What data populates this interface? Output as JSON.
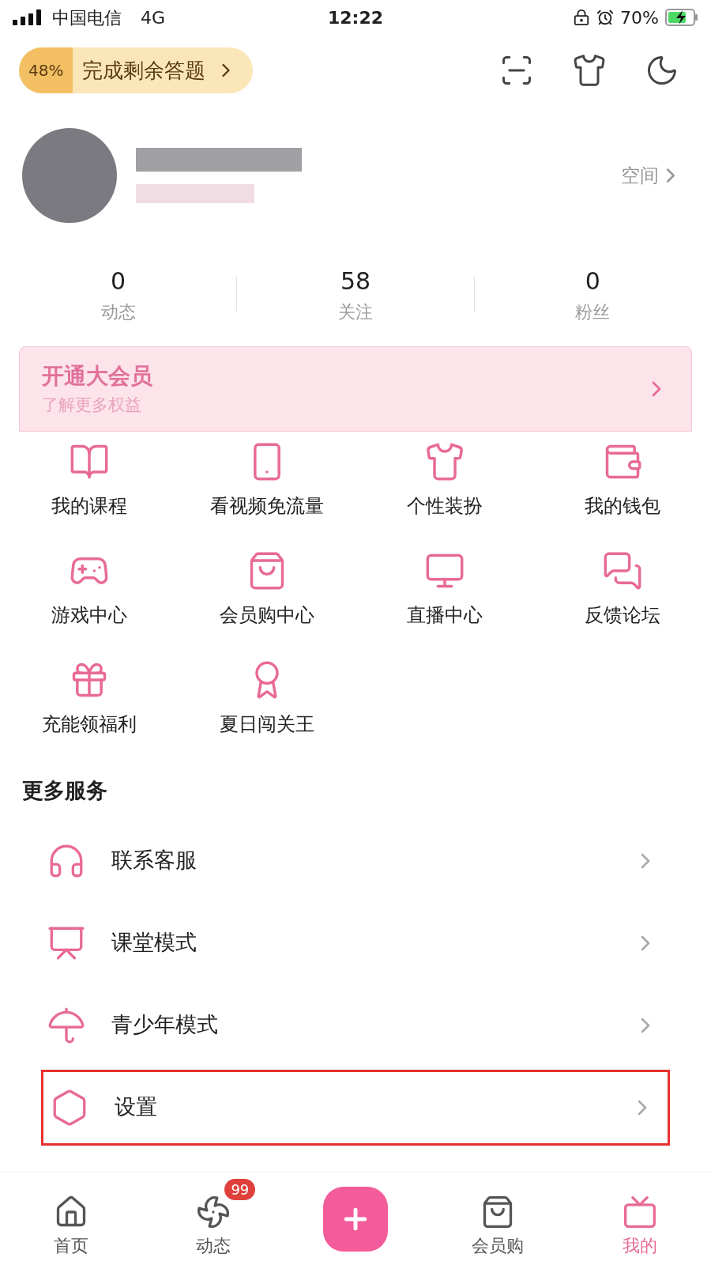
{
  "status_bar": {
    "carrier": "中国电信",
    "network": "4G",
    "time": "12:22",
    "battery": "70%"
  },
  "task_pill": {
    "percent": "48%",
    "label": "完成剩余答题"
  },
  "profile": {
    "space_link": "空间"
  },
  "stats": [
    {
      "value": "0",
      "label": "动态"
    },
    {
      "value": "58",
      "label": "关注"
    },
    {
      "value": "0",
      "label": "粉丝"
    }
  ],
  "vip_card": {
    "title": "开通大会员",
    "subtitle": "了解更多权益"
  },
  "grid": [
    {
      "kind": "course",
      "label": "我的课程"
    },
    {
      "kind": "sim",
      "label": "看视频免流量"
    },
    {
      "kind": "shirt",
      "label": "个性装扮"
    },
    {
      "kind": "wallet",
      "label": "我的钱包"
    },
    {
      "kind": "game",
      "label": "游戏中心"
    },
    {
      "kind": "bag",
      "label": "会员购中心"
    },
    {
      "kind": "live",
      "label": "直播中心"
    },
    {
      "kind": "chat",
      "label": "反馈论坛"
    },
    {
      "kind": "gift",
      "label": "充能领福利"
    },
    {
      "kind": "badge",
      "label": "夏日闯关王"
    }
  ],
  "more_services": {
    "title": "更多服务",
    "items": [
      {
        "kind": "headset",
        "label": "联系客服",
        "highlighted": false
      },
      {
        "kind": "board",
        "label": "课堂模式",
        "highlighted": false
      },
      {
        "kind": "umbrella",
        "label": "青少年模式",
        "highlighted": false
      },
      {
        "kind": "settings",
        "label": "设置",
        "highlighted": true
      }
    ]
  },
  "tab_bar": [
    {
      "kind": "home",
      "label": "首页",
      "selected": false
    },
    {
      "kind": "feed",
      "label": "动态",
      "badge": "99",
      "selected": false
    },
    {
      "kind": "publish",
      "selected": false
    },
    {
      "kind": "shop",
      "label": "会员购",
      "selected": false
    },
    {
      "kind": "me",
      "label": "我的",
      "selected": true
    }
  ]
}
